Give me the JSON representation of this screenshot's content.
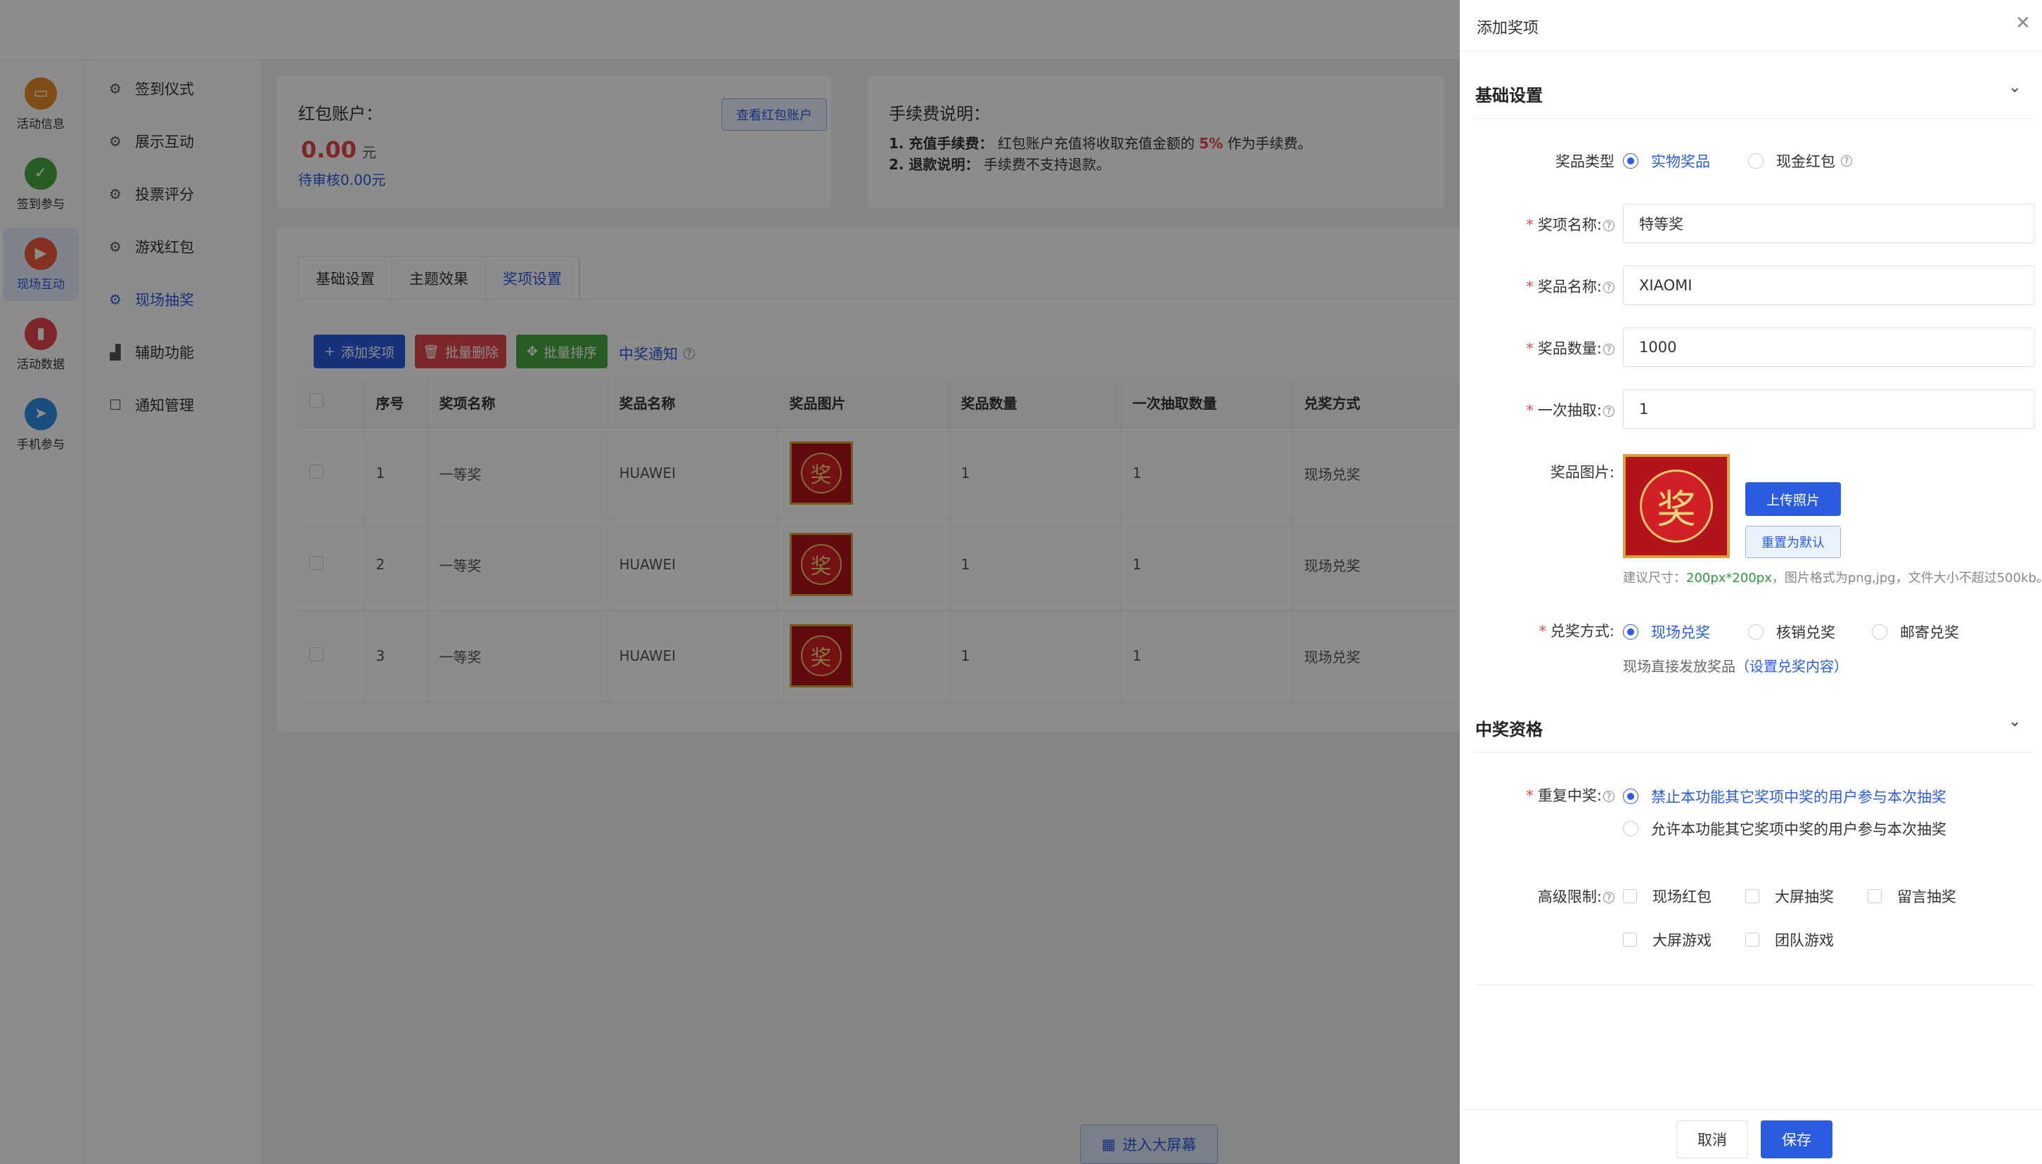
{
  "rail": [
    {
      "label": "活动信息",
      "icon": "activity-info-icon",
      "color": "#e98d2a"
    },
    {
      "label": "签到参与",
      "icon": "checkin-icon",
      "color": "#4aa844"
    },
    {
      "label": "现场互动",
      "icon": "live-interaction-icon",
      "color": "#f05a3c"
    },
    {
      "label": "活动数据",
      "icon": "data-chart-icon",
      "color": "#e5484d"
    },
    {
      "label": "手机参与",
      "icon": "paper-plane-icon",
      "color": "#2f8de4"
    }
  ],
  "menu": [
    {
      "label": "签到仪式"
    },
    {
      "label": "展示互动"
    },
    {
      "label": "投票评分"
    },
    {
      "label": "游戏红包"
    },
    {
      "label": "现场抽奖"
    },
    {
      "label": "辅助功能"
    },
    {
      "label": "通知管理"
    }
  ],
  "account": {
    "title": "红包账户：",
    "amount": "0.00",
    "unit": "元",
    "pending": "待审核0.00元",
    "view_button": "查看红包账户"
  },
  "fee": {
    "title": "手续费说明：",
    "line1_label": "1. 充值手续费：",
    "line1_text": "红包账户充值将收取充值金额的",
    "line1_rate": "5%",
    "line1_suffix": "作为手续费。",
    "line2_label": "2. 退款说明：",
    "line2_text": "手续费不支持退款。"
  },
  "tabs": [
    "基础设置",
    "主题效果",
    "奖项设置"
  ],
  "toolbar": {
    "add": "添加奖项",
    "batch_delete": "批量删除",
    "batch_sort": "批量排序",
    "notice": "中奖通知"
  },
  "table": {
    "headers": [
      "序号",
      "奖项名称",
      "奖品名称",
      "奖品图片",
      "奖品数量",
      "一次抽取数量",
      "兑奖方式"
    ],
    "rows": [
      {
        "no": "1",
        "award": "一等奖",
        "prize": "HUAWEI",
        "img": "奖",
        "qty": "1",
        "once": "1",
        "redeem": "现场兑奖"
      },
      {
        "no": "2",
        "award": "一等奖",
        "prize": "HUAWEI",
        "img": "奖",
        "qty": "1",
        "once": "1",
        "redeem": "现场兑奖"
      },
      {
        "no": "3",
        "award": "一等奖",
        "prize": "HUAWEI",
        "img": "奖",
        "qty": "1",
        "once": "1",
        "redeem": "现场兑奖"
      }
    ]
  },
  "bigscreen": "进入大屏幕",
  "drawer": {
    "title": "添加奖项",
    "section1": "基础设置",
    "prize_type_label": "奖品类型",
    "prize_type_options": [
      "实物奖品",
      "现金红包"
    ],
    "award_name_label": "奖项名称:",
    "award_name_value": "特等奖",
    "prize_name_label": "奖品名称:",
    "prize_name_value": "XIAOMI",
    "prize_qty_label": "奖品数量:",
    "prize_qty_value": "1000",
    "once_label": "一次抽取:",
    "once_value": "1",
    "prize_img_label": "奖品图片:",
    "prize_img_char": "奖",
    "upload_button": "上传照片",
    "reset_button": "重置为默认",
    "hint_prefix": "建议尺寸：",
    "hint_size": "200px*200px",
    "hint_suffix": "，图片格式为png,jpg，文件大小不超过500kb。",
    "redeem_label": "兑奖方式:",
    "redeem_options": [
      "现场兑奖",
      "核销兑奖",
      "邮寄兑奖"
    ],
    "redeem_note": "现场直接发放奖品",
    "redeem_link": "（设置兑奖内容）",
    "section2": "中奖资格",
    "repeat_label": "重复中奖:",
    "repeat_options": [
      "禁止本功能其它奖项中奖的用户参与本次抽奖",
      "允许本功能其它奖项中奖的用户参与本次抽奖"
    ],
    "advanced_label": "高级限制:",
    "advanced_options": [
      "现场红包",
      "大屏抽奖",
      "留言抽奖",
      "大屏游戏",
      "团队游戏"
    ],
    "cancel": "取消",
    "save": "保存"
  }
}
